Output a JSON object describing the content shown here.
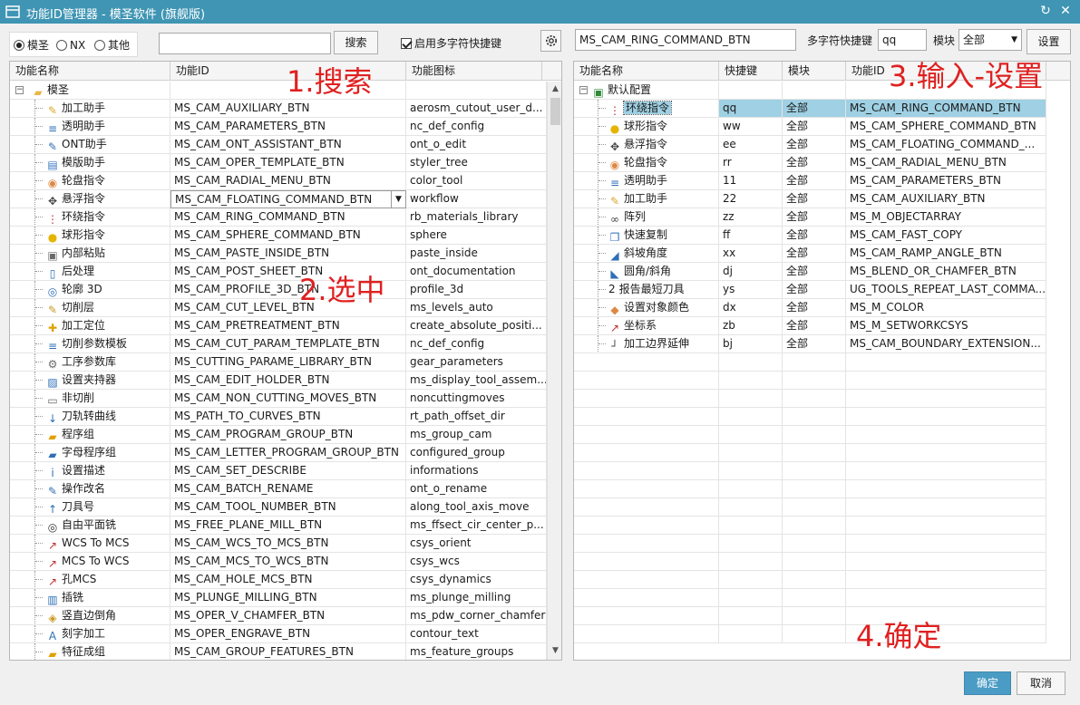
{
  "window": {
    "title": "功能ID管理器 - 模圣软件 (旗舰版)",
    "refresh_icon": "refresh-icon",
    "close_icon": "close-icon"
  },
  "toolbar": {
    "radio_options": [
      "模圣",
      "NX",
      "其他"
    ],
    "radio_selected": 0,
    "search_value": "",
    "search_button": "搜索",
    "multichar_checkbox_label": "启用多字符快捷键",
    "multichar_checked": true,
    "settings_icon": "gear-icon"
  },
  "right_toolbar": {
    "command_id_value": "MS_CAM_RING_COMMAND_BTN",
    "multichar_shortcut_label": "多字符快捷键",
    "shortcut_value": "qq",
    "module_label": "模块",
    "module_selected": "全部",
    "set_button": "设置"
  },
  "left_table": {
    "columns": [
      "功能名称",
      "功能ID",
      "功能图标"
    ],
    "root": {
      "name": "模圣",
      "icon": "folder-icon"
    },
    "rows": [
      {
        "name": "加工助手",
        "id": "MS_CAM_AUXILIARY_BTN",
        "icon_name": "aerosm_cutout_user_d...",
        "icon": "wand-icon"
      },
      {
        "name": "透明助手",
        "id": "MS_CAM_PARAMETERS_BTN",
        "icon_name": "nc_def_config",
        "icon": "def-config-icon"
      },
      {
        "name": "ONT助手",
        "id": "MS_CAM_ONT_ASSISTANT_BTN",
        "icon_name": "ont_o_edit",
        "icon": "ont-edit-icon"
      },
      {
        "name": "模版助手",
        "id": "MS_CAM_OPER_TEMPLATE_BTN",
        "icon_name": "styler_tree",
        "icon": "template-icon"
      },
      {
        "name": "轮盘指令",
        "id": "MS_CAM_RADIAL_MENU_BTN",
        "icon_name": "color_tool",
        "icon": "color-wheel-icon"
      },
      {
        "name": "悬浮指令",
        "id": "MS_CAM_FLOATING_COMMAND_BTN",
        "icon_name": "workflow",
        "icon": "workflow-icon",
        "dropdown": true
      },
      {
        "name": "环绕指令",
        "id": "MS_CAM_RING_COMMAND_BTN",
        "icon_name": "rb_materials_library",
        "icon": "materials-library-icon"
      },
      {
        "name": "球形指令",
        "id": "MS_CAM_SPHERE_COMMAND_BTN",
        "icon_name": "sphere",
        "icon": "sphere-icon"
      },
      {
        "name": "内部粘贴",
        "id": "MS_CAM_PASTE_INSIDE_BTN",
        "icon_name": "paste_inside",
        "icon": "paste-inside-icon"
      },
      {
        "name": "后处理",
        "id": "MS_CAM_POST_SHEET_BTN",
        "icon_name": "ont_documentation",
        "icon": "documentation-icon"
      },
      {
        "name": "轮廓 3D",
        "id": "MS_CAM_PROFILE_3D_BTN",
        "icon_name": "profile_3d",
        "icon": "profile-3d-icon"
      },
      {
        "name": "切削层",
        "id": "MS_CAM_CUT_LEVEL_BTN",
        "icon_name": "ms_levels_auto",
        "icon": "cut-levels-icon"
      },
      {
        "name": "加工定位",
        "id": "MS_CAM_PRETREATMENT_BTN",
        "icon_name": "create_absolute_positi...",
        "icon": "absolute-position-icon"
      },
      {
        "name": "切削参数模板",
        "id": "MS_CAM_CUT_PARAM_TEMPLATE_BTN",
        "icon_name": "nc_def_config",
        "icon": "def-config-icon"
      },
      {
        "name": "工序参数库",
        "id": "MS_CUTTING_PARAME_LIBRARY_BTN",
        "icon_name": "gear_parameters",
        "icon": "gear-parameters-icon"
      },
      {
        "name": "设置夹持器",
        "id": "MS_CAM_EDIT_HOLDER_BTN",
        "icon_name": "ms_display_tool_assem...",
        "icon": "tool-assembly-icon"
      },
      {
        "name": "非切削",
        "id": "MS_CAM_NON_CUTTING_MOVES_BTN",
        "icon_name": "noncuttingmoves",
        "icon": "non-cutting-moves-icon"
      },
      {
        "name": "刀轨转曲线",
        "id": "MS_PATH_TO_CURVES_BTN",
        "icon_name": "rt_path_offset_dir",
        "icon": "path-offset-icon"
      },
      {
        "name": "程序组",
        "id": "MS_CAM_PROGRAM_GROUP_BTN",
        "icon_name": "ms_group_cam",
        "icon": "program-group-icon"
      },
      {
        "name": "字母程序组",
        "id": "MS_CAM_LETTER_PROGRAM_GROUP_BTN",
        "icon_name": "configured_group",
        "icon": "letter-group-icon"
      },
      {
        "name": "设置描述",
        "id": "MS_CAM_SET_DESCRIBE",
        "icon_name": "informations",
        "icon": "information-icon"
      },
      {
        "name": "操作改名",
        "id": "MS_CAM_BATCH_RENAME",
        "icon_name": "ont_o_rename",
        "icon": "rename-icon"
      },
      {
        "name": "刀具号",
        "id": "MS_CAM_TOOL_NUMBER_BTN",
        "icon_name": "along_tool_axis_move",
        "icon": "tool-axis-icon"
      },
      {
        "name": "自由平面铣",
        "id": "MS_FREE_PLANE_MILL_BTN",
        "icon_name": "ms_ffsect_cir_center_p...",
        "icon": "plane-mill-icon"
      },
      {
        "name": "WCS To MCS",
        "id": "MS_CAM_WCS_TO_MCS_BTN",
        "icon_name": "csys_orient",
        "icon": "csys-orient-icon"
      },
      {
        "name": "MCS To WCS",
        "id": "MS_CAM_MCS_TO_WCS_BTN",
        "icon_name": "csys_wcs",
        "icon": "csys-wcs-icon"
      },
      {
        "name": "孔MCS",
        "id": "MS_CAM_HOLE_MCS_BTN",
        "icon_name": "csys_dynamics",
        "icon": "csys-dynamics-icon"
      },
      {
        "name": "插铣",
        "id": "MS_PLUNGE_MILLING_BTN",
        "icon_name": "ms_plunge_milling",
        "icon": "plunge-milling-icon"
      },
      {
        "name": "竖直边倒角",
        "id": "MS_OPER_V_CHAMFER_BTN",
        "icon_name": "ms_pdw_corner_chamfer",
        "icon": "corner-chamfer-icon"
      },
      {
        "name": "刻字加工",
        "id": "MS_OPER_ENGRAVE_BTN",
        "icon_name": "contour_text",
        "icon": "contour-text-icon"
      },
      {
        "name": "特征成组",
        "id": "MS_CAM_GROUP_FEATURES_BTN",
        "icon_name": "ms_feature_groups",
        "icon": "feature-groups-icon"
      }
    ]
  },
  "right_table": {
    "columns": [
      "功能名称",
      "快捷键",
      "模块",
      "功能ID"
    ],
    "root": {
      "name": "默认配置",
      "icon": "config-icon"
    },
    "rows": [
      {
        "name": "环绕指令",
        "key": "qq",
        "module": "全部",
        "id": "MS_CAM_RING_COMMAND_BTN",
        "icon": "materials-library-icon",
        "selected": true
      },
      {
        "name": "球形指令",
        "key": "ww",
        "module": "全部",
        "id": "MS_CAM_SPHERE_COMMAND_BTN",
        "icon": "sphere-icon"
      },
      {
        "name": "悬浮指令",
        "key": "ee",
        "module": "全部",
        "id": "MS_CAM_FLOATING_COMMAND_...",
        "icon": "workflow-icon"
      },
      {
        "name": "轮盘指令",
        "key": "rr",
        "module": "全部",
        "id": "MS_CAM_RADIAL_MENU_BTN",
        "icon": "color-wheel-icon"
      },
      {
        "name": "透明助手",
        "key": "11",
        "module": "全部",
        "id": "MS_CAM_PARAMETERS_BTN",
        "icon": "def-config-icon"
      },
      {
        "name": "加工助手",
        "key": "22",
        "module": "全部",
        "id": "MS_CAM_AUXILIARY_BTN",
        "icon": "wand-icon"
      },
      {
        "name": "阵列",
        "key": "zz",
        "module": "全部",
        "id": "MS_M_OBJECTARRAY",
        "icon": "array-icon"
      },
      {
        "name": "快速复制",
        "key": "ff",
        "module": "全部",
        "id": "MS_CAM_FAST_COPY",
        "icon": "fast-copy-icon"
      },
      {
        "name": "斜坡角度",
        "key": "xx",
        "module": "全部",
        "id": "MS_CAM_RAMP_ANGLE_BTN",
        "icon": "ramp-angle-icon"
      },
      {
        "name": "圆角/斜角",
        "key": "dj",
        "module": "全部",
        "id": "MS_BLEND_OR_CHAMFER_BTN",
        "icon": "blend-chamfer-icon"
      },
      {
        "name": "报告最短刀具",
        "key": "ys",
        "module": "全部",
        "id": "UG_TOOLS_REPEAT_LAST_COMMA...",
        "icon": "report-tool-icon",
        "prefix": "2"
      },
      {
        "name": "设置对象颜色",
        "key": "dx",
        "module": "全部",
        "id": "MS_M_COLOR",
        "icon": "object-color-icon"
      },
      {
        "name": "坐标系",
        "key": "zb",
        "module": "全部",
        "id": "MS_M_SETWORKCSYS",
        "icon": "csys-icon"
      },
      {
        "name": "加工边界延伸",
        "key": "bj",
        "module": "全部",
        "id": "MS_CAM_BOUNDARY_EXTENSION...",
        "icon": "boundary-extension-icon"
      }
    ]
  },
  "annotations": {
    "step1": "1.搜索",
    "step2": "2.选中",
    "step3": "3.输入-设置",
    "step4": "4.确定"
  },
  "footer": {
    "ok_button": "确定",
    "cancel_button": "取消"
  },
  "colors": {
    "titlebar": "#3f95b3",
    "selection": "#9fd0e3",
    "annotation": "#e02020",
    "primary_button": "#4a9cc5"
  }
}
